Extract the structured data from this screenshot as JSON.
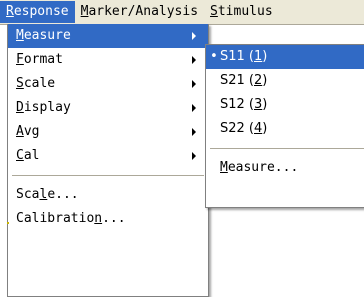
{
  "menubar": {
    "items": [
      {
        "pre": "",
        "key": "R",
        "post": "esponse",
        "active": true
      },
      {
        "pre": "",
        "key": "M",
        "post": "arker/Analysis",
        "active": false
      },
      {
        "pre": "",
        "key": "S",
        "post": "timulus",
        "active": false
      }
    ]
  },
  "response_menu": {
    "items": [
      {
        "pre": "",
        "key": "M",
        "post": "easure",
        "submenu": true
      },
      {
        "pre": "",
        "key": "F",
        "post": "ormat",
        "submenu": true
      },
      {
        "pre": "",
        "key": "S",
        "post": "cale",
        "submenu": true
      },
      {
        "pre": "",
        "key": "D",
        "post": "isplay",
        "submenu": true
      },
      {
        "pre": "",
        "key": "A",
        "post": "vg",
        "submenu": true
      },
      {
        "pre": "",
        "key": "C",
        "post": "al",
        "submenu": true
      }
    ],
    "items2": [
      {
        "pre": "Sca",
        "key": "l",
        "post": "e..."
      },
      {
        "pre": "Calibratio",
        "key": "n",
        "post": "..."
      }
    ]
  },
  "measure_submenu": {
    "bullet": "•",
    "items": [
      {
        "pre": "S11 (",
        "key": "1",
        "post": ")",
        "checked": true
      },
      {
        "pre": "S21 (",
        "key": "2",
        "post": ")",
        "checked": false
      },
      {
        "pre": "S12 (",
        "key": "3",
        "post": ")",
        "checked": false
      },
      {
        "pre": "S22 (",
        "key": "4",
        "post": ")",
        "checked": false
      }
    ],
    "extra": {
      "pre": "",
      "key": "M",
      "post": "easure..."
    }
  },
  "colors": {
    "highlight": "#316ac5",
    "menubar_bg": "#ece9d8"
  }
}
